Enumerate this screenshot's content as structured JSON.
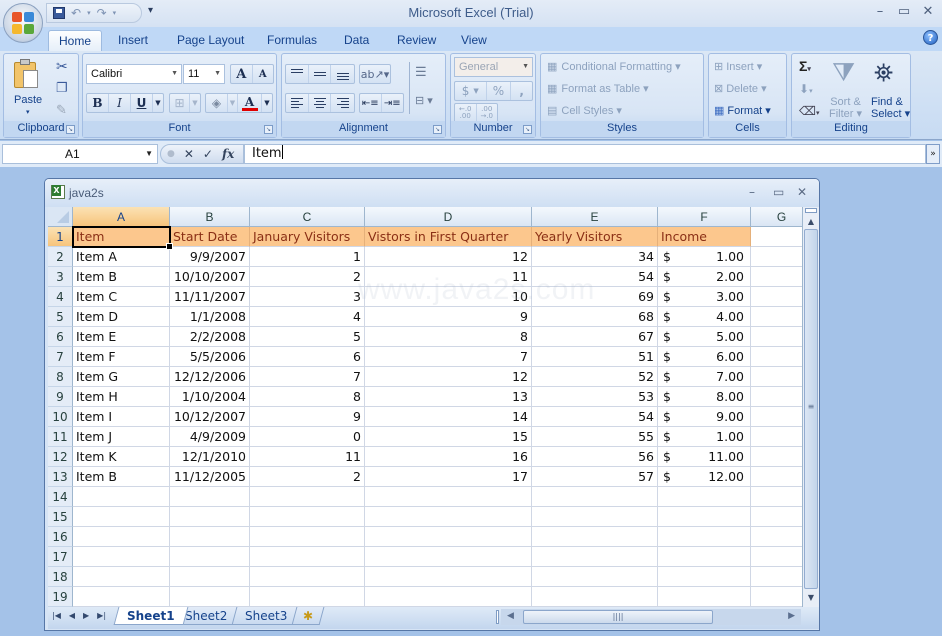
{
  "app": {
    "title": "Microsoft Excel (Trial)",
    "window_controls": {
      "minimize": "–",
      "maximize": "▭",
      "close": "✕"
    }
  },
  "quick_access": {
    "undo": "↶",
    "redo": "↷",
    "customize": "▾"
  },
  "ribbon_tabs": [
    {
      "label": "Home",
      "active": true
    },
    {
      "label": "Insert"
    },
    {
      "label": "Page Layout"
    },
    {
      "label": "Formulas"
    },
    {
      "label": "Data"
    },
    {
      "label": "Review"
    },
    {
      "label": "View"
    }
  ],
  "help": "?",
  "ribbon": {
    "clipboard": {
      "label": "Clipboard",
      "paste": "Paste"
    },
    "font": {
      "label": "Font",
      "font_name": "Calibri",
      "font_size": "11",
      "grow": "A",
      "shrink": "A",
      "bold": "B",
      "italic": "I",
      "underline": "U",
      "font_color": "#e00000"
    },
    "alignment": {
      "label": "Alignment"
    },
    "number": {
      "label": "Number",
      "format": "General",
      "currency": "$",
      "percent": "%",
      "comma": ",",
      "inc_decimal": "←.0 .00",
      "dec_decimal": ".00 →.0"
    },
    "styles": {
      "label": "Styles",
      "conditional": "Conditional Formatting",
      "format_table": "Format as Table",
      "cell_styles": "Cell Styles"
    },
    "cells": {
      "label": "Cells",
      "insert": "Insert",
      "delete": "Delete",
      "format": "Format"
    },
    "editing": {
      "label": "Editing",
      "sum": "Σ",
      "sort": "Sort &",
      "filter": "Filter",
      "find": "Find &",
      "select": "Select"
    }
  },
  "formula_bar": {
    "name_box": "A1",
    "cancel": "✕",
    "enter": "✓",
    "fx": "fx",
    "value": "Item"
  },
  "workbook": {
    "name": "java2s",
    "watermark": "www.java2s.com",
    "columns": [
      "A",
      "B",
      "C",
      "D",
      "E",
      "F",
      "G"
    ],
    "headers": [
      "Item",
      "Start Date",
      "January Visitors",
      "Vistors in First Quarter",
      "Yearly Visitors",
      "Income"
    ],
    "rows": [
      [
        "Item A",
        "9/9/2007",
        "1",
        "12",
        "34",
        "1.00"
      ],
      [
        "Item B",
        "10/10/2007",
        "2",
        "11",
        "54",
        "2.00"
      ],
      [
        "Item C",
        "11/11/2007",
        "3",
        "10",
        "69",
        "3.00"
      ],
      [
        "Item D",
        "1/1/2008",
        "4",
        "9",
        "68",
        "4.00"
      ],
      [
        "Item E",
        "2/2/2008",
        "5",
        "8",
        "67",
        "5.00"
      ],
      [
        "Item F",
        "5/5/2006",
        "6",
        "7",
        "51",
        "6.00"
      ],
      [
        "Item G",
        "12/12/2006",
        "7",
        "12",
        "52",
        "7.00"
      ],
      [
        "Item H",
        "1/10/2004",
        "8",
        "13",
        "53",
        "8.00"
      ],
      [
        "Item I",
        "10/12/2007",
        "9",
        "14",
        "54",
        "9.00"
      ],
      [
        "Item J",
        "4/9/2009",
        "0",
        "15",
        "55",
        "1.00"
      ],
      [
        "Item K",
        "12/1/2010",
        "11",
        "16",
        "56",
        "11.00"
      ],
      [
        "Item B",
        "11/12/2005",
        "2",
        "17",
        "57",
        "12.00"
      ]
    ],
    "currency_symbol": "$",
    "row_numbers": [
      "1",
      "2",
      "3",
      "4",
      "5",
      "6",
      "7",
      "8",
      "9",
      "10",
      "11",
      "12",
      "13",
      "14",
      "15",
      "16",
      "17",
      "18",
      "19"
    ],
    "selected_cell": "A1",
    "sheets": [
      {
        "label": "Sheet1",
        "active": true
      },
      {
        "label": "Sheet2"
      },
      {
        "label": "Sheet3"
      }
    ]
  }
}
